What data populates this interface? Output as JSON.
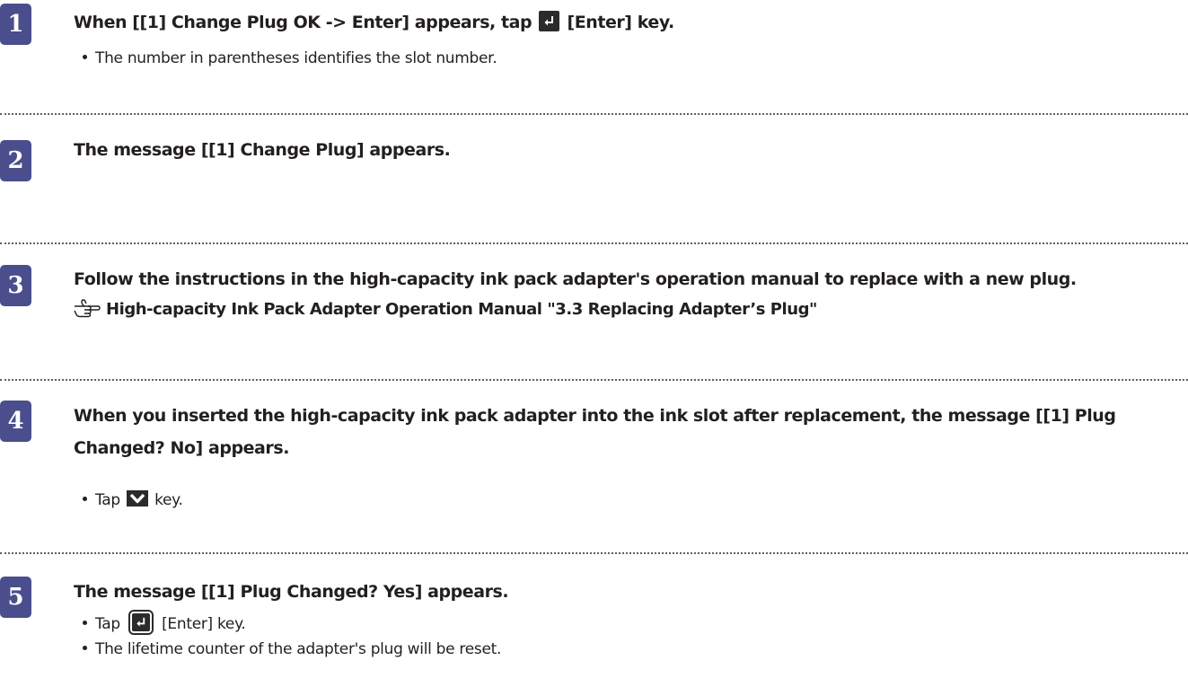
{
  "steps": [
    {
      "number": "1",
      "heading_before": "When [[1] Change Plug OK -> Enter] appears, tap ",
      "heading_after": " [Enter] key.",
      "bullets": [
        "The number in parentheses identifies the slot number."
      ]
    },
    {
      "number": "2",
      "heading": "The message [[1] Change Plug] appears."
    },
    {
      "number": "3",
      "heading": "Follow the instructions in the high-capacity ink pack adapter's operation manual to replace with a new plug.",
      "reference": "High-capacity Ink Pack Adapter Operation Manual \"3.3 Replacing Adapter’s Plug\""
    },
    {
      "number": "4",
      "heading": "When you inserted the high-capacity ink pack adapter into the ink slot after replacement, the message [[1] Plug Changed? No] appears.",
      "bullet_before": "Tap ",
      "bullet_after": " key."
    },
    {
      "number": "5",
      "heading": "The message [[1] Plug Changed? Yes] appears.",
      "bullet1_before": "Tap ",
      "bullet1_after": " [Enter] key.",
      "bullet2": "The lifetime counter of the adapter's plug will be reset."
    }
  ],
  "colors": {
    "badge": "#4a4e8d",
    "text": "#231f20",
    "key": "#2b2b2b"
  },
  "icons": [
    "enter-key-icon",
    "down-arrow-key-icon",
    "reference-hand-icon"
  ]
}
